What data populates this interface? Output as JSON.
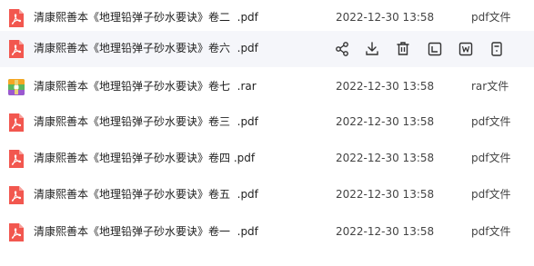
{
  "files": [
    {
      "name": "清康熙善本《地理铅弹子砂水要诀》卷二  .pdf",
      "date": "2022-12-30 13:58",
      "type": "pdf文件",
      "icon": "pdf-icon"
    },
    {
      "name": "清康熙善本《地理铅弹子砂水要诀》卷六  .pdf",
      "date": "",
      "type": "",
      "icon": "pdf-icon"
    },
    {
      "name": "清康熙善本《地理铅弹子砂水要诀》卷七  .rar",
      "date": "2022-12-30 13:58",
      "type": "rar文件",
      "icon": "rar-archive-icon"
    },
    {
      "name": "清康熙善本《地理铅弹子砂水要诀》卷三  .pdf",
      "date": "2022-12-30 13:58",
      "type": "pdf文件",
      "icon": "pdf-icon"
    },
    {
      "name": "清康熙善本《地理铅弹子砂水要诀》卷四 .pdf",
      "date": "2022-12-30 13:58",
      "type": "pdf文件",
      "icon": "pdf-icon"
    },
    {
      "name": "清康熙善本《地理铅弹子砂水要诀》卷五  .pdf",
      "date": "2022-12-30 13:58",
      "type": "pdf文件",
      "icon": "pdf-icon"
    },
    {
      "name": "清康熙善本《地理铅弹子砂水要诀》卷一  .pdf",
      "date": "2022-12-30 13:58",
      "type": "pdf文件",
      "icon": "pdf-icon"
    }
  ],
  "hover_actions": [
    "share-icon",
    "download-icon",
    "delete-icon",
    "move-icon",
    "rename-icon",
    "more-icon"
  ],
  "colors": {
    "pdf_red": "#f2574f",
    "rar_green": "#5cb85c",
    "rar_orange": "#f5a623",
    "hover_bg": "#f5f6fa",
    "action_gray": "#333333"
  }
}
